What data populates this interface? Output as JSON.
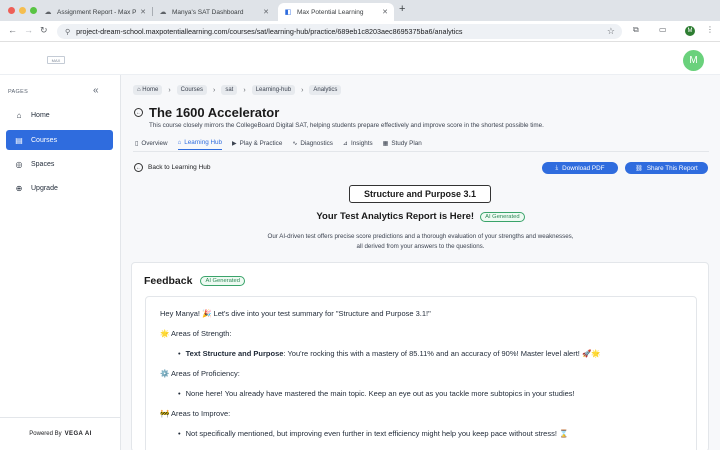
{
  "browser": {
    "tabs": [
      {
        "label": "Assignment Report - Max Pot",
        "icon": "cloud-icon",
        "active": false
      },
      {
        "label": "Manya's SAT Dashboard",
        "icon": "cloud-icon",
        "active": false
      },
      {
        "label": "Max Potential Learning",
        "icon": "mp-logo-icon",
        "active": true
      }
    ],
    "new_tab_label": "+",
    "url": "project-dream-school.maxpotentiallearning.com/courses/sat/learning-hub/practice/689eb1c8203aec8695375ba6/analytics",
    "profile_initial": "M"
  },
  "header": {
    "logo_text": "MAX",
    "avatar_initial": "M"
  },
  "sidebar": {
    "section_label": "PAGES",
    "items": [
      {
        "label": "Home",
        "icon": "home-icon",
        "active": false
      },
      {
        "label": "Courses",
        "icon": "book-icon",
        "active": true
      },
      {
        "label": "Spaces",
        "icon": "spaces-icon",
        "active": false
      },
      {
        "label": "Upgrade",
        "icon": "upgrade-icon",
        "active": false
      }
    ],
    "powered_prefix": "Powered By",
    "powered_brand": "VEGA AI"
  },
  "breadcrumb": [
    "Home",
    "Courses",
    "sat",
    "Learning-hub",
    "Analytics"
  ],
  "course": {
    "title": "The 1600 Accelerator",
    "description": "This course closely mirrors the CollegeBoard Digital SAT, helping students prepare effectively and improve score in the shortest possible time."
  },
  "subnav": [
    {
      "label": "Overview",
      "icon": "document-icon",
      "active": false
    },
    {
      "label": "Learning Hub",
      "icon": "home-icon",
      "active": true
    },
    {
      "label": "Play & Practice",
      "icon": "play-icon",
      "active": false
    },
    {
      "label": "Diagnostics",
      "icon": "pulse-icon",
      "active": false
    },
    {
      "label": "Insights",
      "icon": "chart-icon",
      "active": false
    },
    {
      "label": "Study Plan",
      "icon": "calendar-icon",
      "active": false
    }
  ],
  "actions": {
    "back_label": "Back to Learning Hub",
    "download_label": "Download PDF",
    "share_label": "Share This Report"
  },
  "report": {
    "chip": "Structure and Purpose 3.1",
    "headline": "Your Test Analytics Report is Here!",
    "ai_badge": "AI Generated",
    "description_line1": "Our AI-driven test offers precise score predictions and a thorough evaluation of your strengths and weaknesses,",
    "description_line2": "all derived from your answers to the questions."
  },
  "feedback": {
    "title": "Feedback",
    "ai_badge": "AI Generated",
    "greeting": "Hey Manya! 🎉 Let's dive into your test summary for \"Structure and Purpose 3.1!\"",
    "strength_heading": "🌟 Areas of Strength:",
    "strength_bold": "Text Structure and Purpose",
    "strength_text": ": You're rocking this with a mastery of 85.11% and an accuracy of 90%! Master level alert! 🚀🌟",
    "proficiency_heading": "⚙️ Areas of Proficiency:",
    "proficiency_text": "None here! You already have mastered the main topic. Keep an eye out as you tackle more subtopics in your studies!",
    "improve_heading": "🚧 Areas to Improve:",
    "improve_text": "Not specifically mentioned, but improving even further in text efficiency might help you keep pace without stress! ⌛"
  }
}
